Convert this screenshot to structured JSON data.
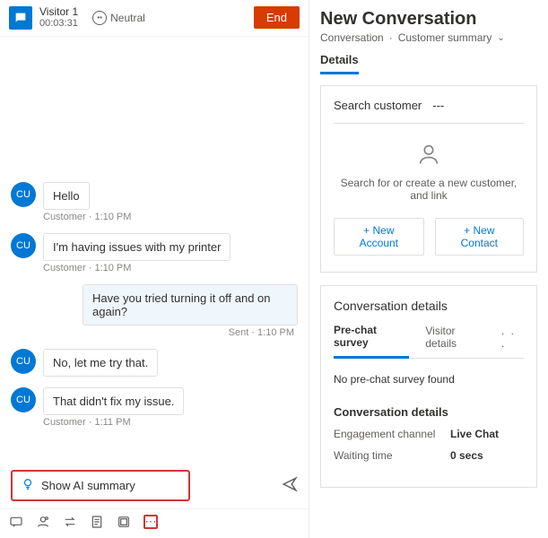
{
  "header": {
    "visitor_name": "Visitor 1",
    "timer": "00:03:31",
    "sentiment": "Neutral",
    "end_label": "End"
  },
  "messages": [
    {
      "from": "customer",
      "avatar": "CU",
      "text": "Hello",
      "meta": "Customer · 1:10 PM"
    },
    {
      "from": "customer",
      "avatar": "CU",
      "text": "I'm having issues with my printer",
      "meta": "Customer · 1:10 PM"
    },
    {
      "from": "agent",
      "text": "Have you tried turning it off and on again?",
      "meta": "Sent · 1:10 PM"
    },
    {
      "from": "customer",
      "avatar": "CU",
      "text": "No, let me try that.",
      "meta": ""
    },
    {
      "from": "customer",
      "avatar": "CU",
      "text": "That didn't fix my issue.",
      "meta": "Customer · 1:11 PM"
    }
  ],
  "ai_summary_label": "Show AI summary",
  "right": {
    "title": "New Conversation",
    "breadcrumb_a": "Conversation",
    "breadcrumb_b": "Customer summary",
    "details_tab": "Details",
    "search_label": "Search customer",
    "search_value": "---",
    "search_prompt": "Search for or create a new customer, and link",
    "new_account": "+ New Account",
    "new_contact": "+ New Contact",
    "convo_section": "Conversation details",
    "subtab_a": "Pre-chat survey",
    "subtab_b": "Visitor details",
    "empty_msg": "No pre-chat survey found",
    "detail_subtitle": "Conversation details",
    "kv": [
      {
        "k": "Engagement channel",
        "v": "Live Chat"
      },
      {
        "k": "Waiting time",
        "v": "0 secs"
      }
    ]
  }
}
